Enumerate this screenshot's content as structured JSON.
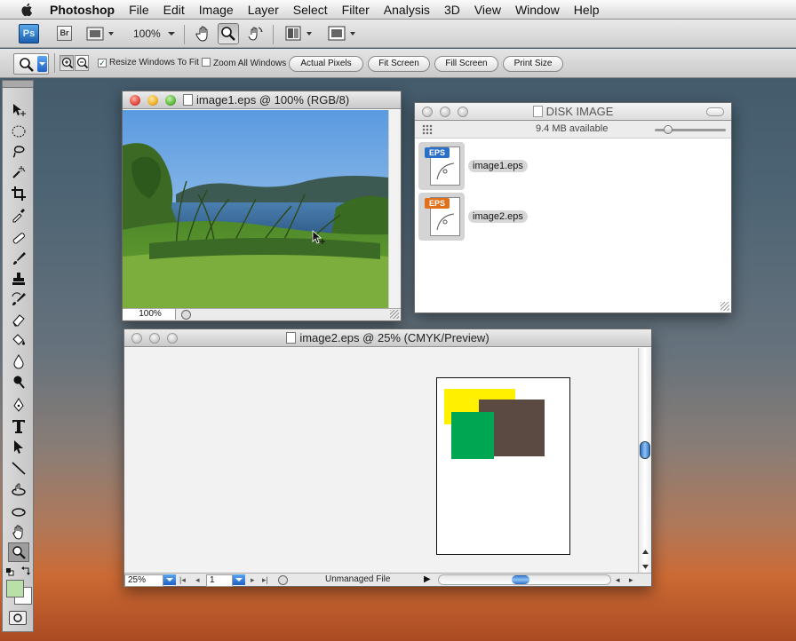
{
  "menubar": {
    "app_name": "Photoshop",
    "items": [
      "File",
      "Edit",
      "Image",
      "Layer",
      "Select",
      "Filter",
      "Analysis",
      "3D",
      "View",
      "Window",
      "Help"
    ]
  },
  "app_bar": {
    "ps_logo": "Ps",
    "bridge_logo": "Br",
    "zoom_value": "100%",
    "icons": [
      "apple-icon",
      "film-strip-icon",
      "hand-icon",
      "zoom-icon",
      "rotate-view-icon",
      "arrange-documents-icon",
      "screen-mode-icon"
    ]
  },
  "options_bar": {
    "resize_windows_label": "Resize Windows To Fit",
    "resize_windows_checked": true,
    "zoom_all_label": "Zoom All Windows",
    "zoom_all_checked": false,
    "buttons": [
      "Actual Pixels",
      "Fit Screen",
      "Fill Screen",
      "Print Size"
    ]
  },
  "tools": [
    "move",
    "marquee",
    "lasso",
    "quick-selection",
    "crop",
    "eyedropper",
    "spot-healing",
    "brush",
    "clone-stamp",
    "history-brush",
    "eraser",
    "paint-bucket",
    "blur",
    "dodge",
    "pen",
    "type",
    "path-selection",
    "line",
    "3d-rotate",
    "3d-orbit",
    "hand",
    "zoom"
  ],
  "colors": {
    "foreground": "#b8e0a8",
    "background": "#ffffff"
  },
  "image1_window": {
    "title": "image1.eps @ 100% (RGB/8)",
    "zoom": "100%"
  },
  "disk_window": {
    "title": "DISK IMAGE",
    "available": "9.4 MB available",
    "files": [
      {
        "badge": "EPS",
        "name": "image1.eps",
        "badge_color": "#2a6fc8"
      },
      {
        "badge": "EPS",
        "name": "image2.eps",
        "badge_color": "#e0701c"
      }
    ]
  },
  "image2_window": {
    "title": "image2.eps @ 25% (CMYK/Preview)",
    "zoom": "25%",
    "page": "1",
    "status": "Unmanaged File",
    "swatch_colors": {
      "yellow": "#fff000",
      "brown": "#5a4a42",
      "green": "#00a651"
    }
  }
}
